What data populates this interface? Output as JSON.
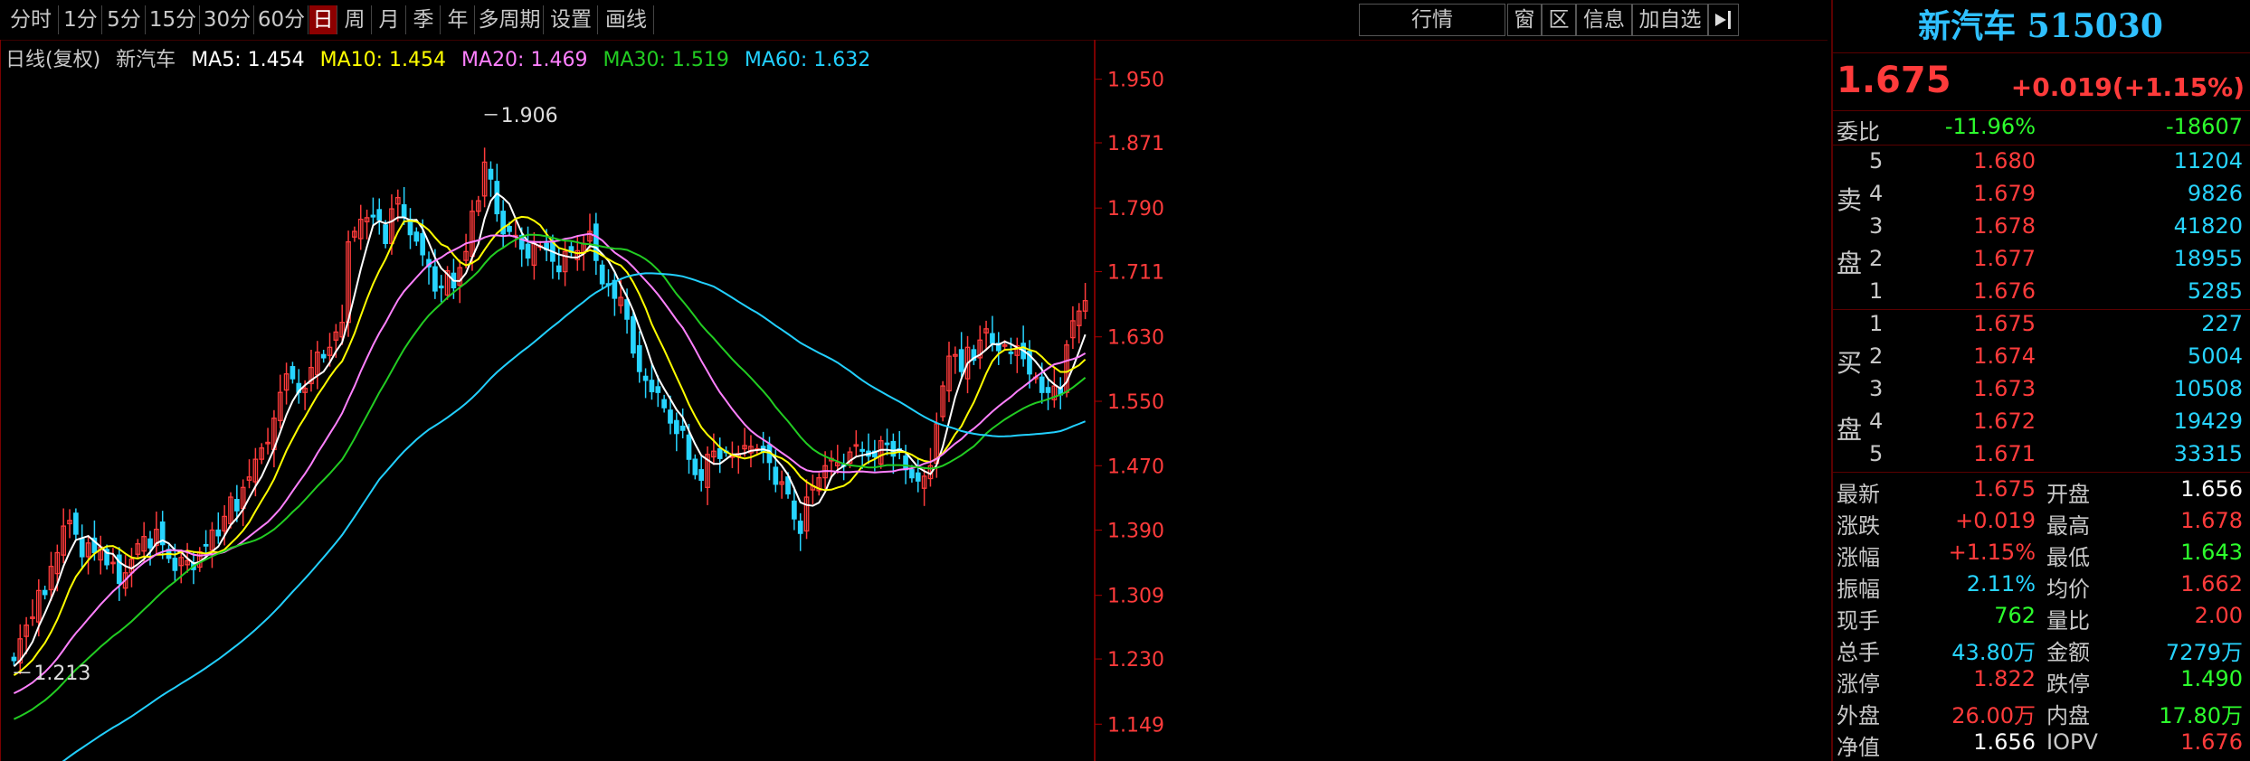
{
  "toolbar": {
    "periods": [
      "分时",
      "1分",
      "5分",
      "15分",
      "30分",
      "60分",
      "日",
      "周",
      "月",
      "季",
      "年",
      "多周期",
      "设置",
      "画线"
    ],
    "active_period": "日",
    "quote_label": "行情",
    "window_label": "窗",
    "region_label": "区",
    "info_label": "信息",
    "add_fav_label": "加自选"
  },
  "legend": {
    "period": "日线(复权)",
    "name": "新汽车",
    "ma5": "MA5: 1.454",
    "ma10": "MA10: 1.454",
    "ma20": "MA20: 1.469",
    "ma30": "MA30: 1.519",
    "ma60": "MA60: 1.632"
  },
  "colors": {
    "up": "#ff3b3b",
    "down": "#27d4ff",
    "ma5": "#ffffff",
    "ma10": "#ffff00",
    "ma20": "#ff80ff",
    "ma30": "#22cc22",
    "ma60": "#22d0ff"
  },
  "chart_data": {
    "type": "candlestick",
    "ylim": [
      1.11,
      1.99
    ],
    "y_ticks": [
      "1.950",
      "1.871",
      "1.790",
      "1.711",
      "1.630",
      "1.550",
      "1.470",
      "1.390",
      "1.309",
      "1.230",
      "1.149"
    ],
    "y_tick_values": [
      1.95,
      1.871,
      1.79,
      1.711,
      1.63,
      1.55,
      1.47,
      1.39,
      1.309,
      1.23,
      1.149
    ],
    "high_annotation": "1.906",
    "high_value": 1.906,
    "low_annotation": "1.213",
    "low_value": 1.213,
    "close": [
      1.228,
      1.255,
      1.272,
      1.282,
      1.315,
      1.31,
      1.345,
      1.362,
      1.395,
      1.402,
      1.385,
      1.357,
      1.374,
      1.362,
      1.369,
      1.347,
      1.35,
      1.324,
      1.337,
      1.354,
      1.373,
      1.382,
      1.368,
      1.391,
      1.372,
      1.355,
      1.34,
      1.356,
      1.352,
      1.341,
      1.363,
      1.371,
      1.39,
      1.383,
      1.407,
      1.431,
      1.414,
      1.443,
      1.456,
      1.478,
      1.492,
      1.499,
      1.529,
      1.561,
      1.584,
      1.578,
      1.561,
      1.566,
      1.592,
      1.611,
      1.604,
      1.617,
      1.636,
      1.648,
      1.748,
      1.761,
      1.776,
      1.778,
      1.779,
      1.775,
      1.746,
      1.789,
      1.803,
      1.779,
      1.757,
      1.749,
      1.732,
      1.717,
      1.687,
      1.691,
      1.712,
      1.691,
      1.716,
      1.736,
      1.786,
      1.799,
      1.847,
      1.826,
      1.783,
      1.758,
      1.761,
      1.756,
      1.739,
      1.728,
      1.746,
      1.743,
      1.738,
      1.724,
      1.711,
      1.736,
      1.735,
      1.737,
      1.746,
      1.761,
      1.725,
      1.696,
      1.694,
      1.678,
      1.679,
      1.652,
      1.61,
      1.587,
      1.576,
      1.562,
      1.561,
      1.542,
      1.523,
      1.51,
      1.514,
      1.478,
      1.459,
      1.452,
      1.484,
      1.488,
      1.479,
      1.487,
      1.482,
      1.485,
      1.495,
      1.494,
      1.491,
      1.487,
      1.474,
      1.447,
      1.45,
      1.435,
      1.404,
      1.386,
      1.431,
      1.445,
      1.455,
      1.47,
      1.479,
      1.474,
      1.47,
      1.487,
      1.496,
      1.488,
      1.482,
      1.481,
      1.501,
      1.497,
      1.482,
      1.488,
      1.465,
      1.455,
      1.451,
      1.457,
      1.47,
      1.522,
      1.569,
      1.606,
      1.608,
      1.587,
      1.617,
      1.601,
      1.626,
      1.64,
      1.622,
      1.613,
      1.62,
      1.61,
      1.619,
      1.603,
      1.584,
      1.58,
      1.561,
      1.561,
      1.569,
      1.558,
      1.62,
      1.65,
      1.662,
      1.675
    ],
    "ma_series": [
      {
        "name": "MA5",
        "last": 1.454
      },
      {
        "name": "MA10",
        "last": 1.454
      },
      {
        "name": "MA20",
        "last": 1.469
      },
      {
        "name": "MA30",
        "last": 1.519
      },
      {
        "name": "MA60",
        "last": 1.632
      }
    ]
  },
  "panel": {
    "title": "新汽车 515030",
    "price": "1.675",
    "change": "+0.019(+1.15%)",
    "weibi_label": "委比",
    "weibi_pct": "-11.96%",
    "weibi_diff": "-18607",
    "sell_label_1": "卖",
    "sell_label_2": "盘",
    "buy_label_1": "买",
    "buy_label_2": "盘",
    "asks": [
      {
        "level": "5",
        "price": "1.680",
        "vol": "11204"
      },
      {
        "level": "4",
        "price": "1.679",
        "vol": "9826"
      },
      {
        "level": "3",
        "price": "1.678",
        "vol": "41820"
      },
      {
        "level": "2",
        "price": "1.677",
        "vol": "18955"
      },
      {
        "level": "1",
        "price": "1.676",
        "vol": "5285"
      }
    ],
    "bids": [
      {
        "level": "1",
        "price": "1.675",
        "vol": "227"
      },
      {
        "level": "2",
        "price": "1.674",
        "vol": "5004"
      },
      {
        "level": "3",
        "price": "1.673",
        "vol": "10508"
      },
      {
        "level": "4",
        "price": "1.672",
        "vol": "19429"
      },
      {
        "level": "5",
        "price": "1.671",
        "vol": "33315"
      }
    ],
    "stats": [
      {
        "l1": "最新",
        "v1": "1.675",
        "c1": "red",
        "l2": "开盘",
        "v2": "1.656",
        "c2": "white"
      },
      {
        "l1": "涨跌",
        "v1": "+0.019",
        "c1": "red",
        "l2": "最高",
        "v2": "1.678",
        "c2": "red"
      },
      {
        "l1": "涨幅",
        "v1": "+1.15%",
        "c1": "red",
        "l2": "最低",
        "v2": "1.643",
        "c2": "green"
      },
      {
        "l1": "振幅",
        "v1": "2.11%",
        "c1": "cyan",
        "l2": "均价",
        "v2": "1.662",
        "c2": "red"
      },
      {
        "l1": "现手",
        "v1": "762",
        "c1": "green",
        "l2": "量比",
        "v2": "2.00",
        "c2": "red"
      },
      {
        "l1": "总手",
        "v1": "43.80万",
        "c1": "cyan",
        "l2": "金额",
        "v2": "7279万",
        "c2": "cyan"
      },
      {
        "l1": "涨停",
        "v1": "1.822",
        "c1": "red",
        "l2": "跌停",
        "v2": "1.490",
        "c2": "green"
      },
      {
        "l1": "外盘",
        "v1": "26.00万",
        "c1": "red",
        "l2": "内盘",
        "v2": "17.80万",
        "c2": "green"
      },
      {
        "l1": "净值",
        "v1": "1.656",
        "c1": "white",
        "l2": "IOPV",
        "v2": "1.676",
        "c2": "red"
      }
    ]
  }
}
